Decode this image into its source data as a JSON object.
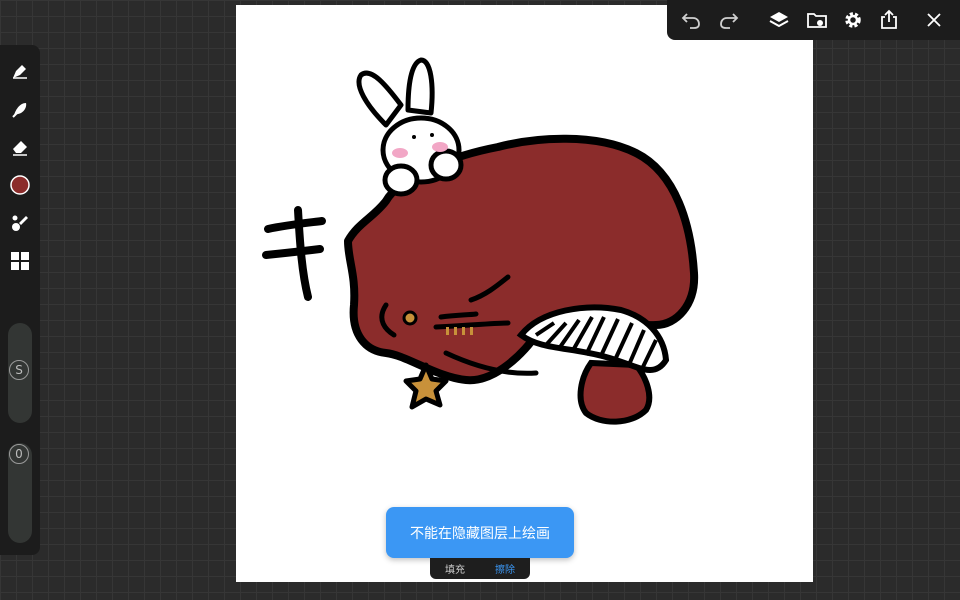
{
  "toolbar": {
    "tools": [
      {
        "name": "pen-tool",
        "icon": "pen-icon"
      },
      {
        "name": "smudge-tool",
        "icon": "smudge-icon"
      },
      {
        "name": "eraser-tool",
        "icon": "eraser-icon"
      },
      {
        "name": "color-picker",
        "icon": "color-swatch-icon",
        "color": "#8b2c2b"
      },
      {
        "name": "brush-library",
        "icon": "brush-icon"
      },
      {
        "name": "grid-tool",
        "icon": "grid-icon"
      }
    ],
    "size_slider": {
      "label": "S"
    },
    "opacity_slider": {
      "label": "0"
    }
  },
  "topbar": {
    "buttons": [
      "undo-icon",
      "redo-icon",
      "layers-icon",
      "gallery-icon",
      "settings-icon",
      "share-icon",
      "close-icon"
    ]
  },
  "toast": {
    "message": "不能在隐藏图层上绘画"
  },
  "bottom_bar": {
    "fill_label": "填充",
    "erase_label": "擦除"
  },
  "colors": {
    "accent": "#3b97f4",
    "brush_color": "#8b2c2b",
    "star": "#c8913a"
  }
}
